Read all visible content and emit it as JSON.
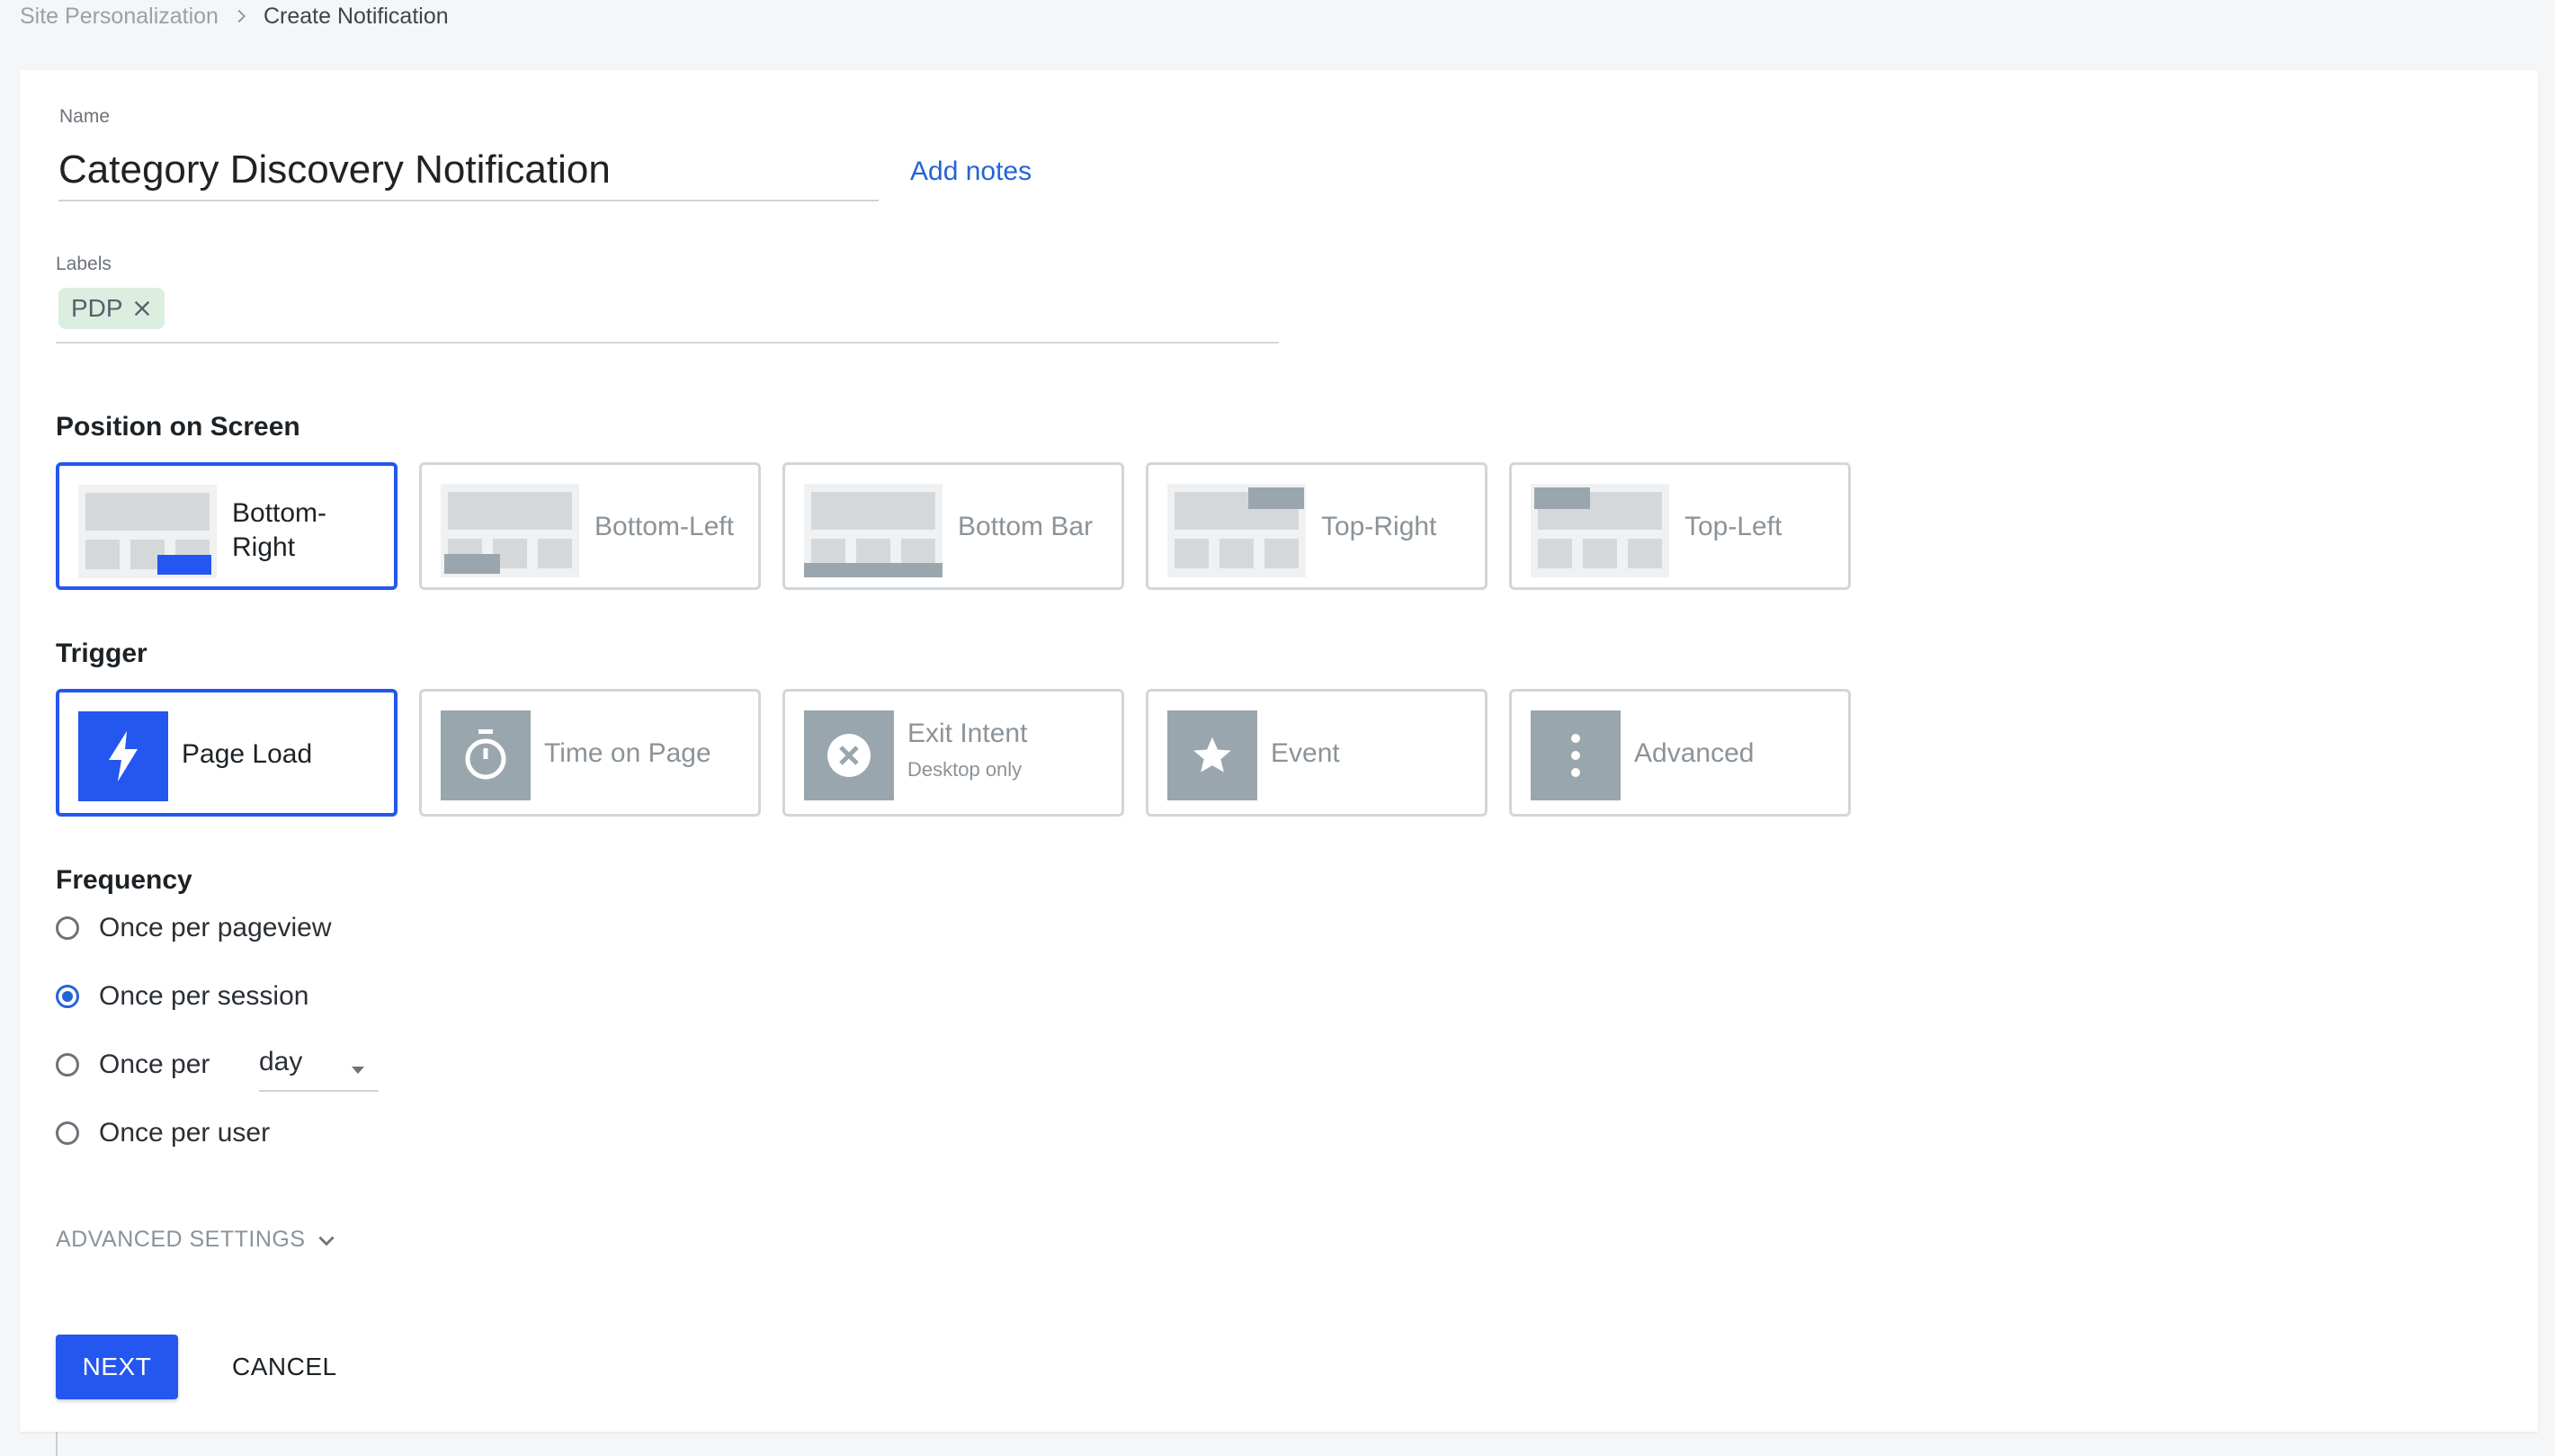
{
  "breadcrumb": {
    "parent": "Site Personalization",
    "current": "Create Notification"
  },
  "form": {
    "name_label": "Name",
    "name_value": "Category Discovery Notification",
    "add_notes": "Add notes",
    "labels_label": "Labels",
    "labels": [
      "PDP"
    ]
  },
  "position": {
    "title": "Position on Screen",
    "options": [
      {
        "line1": "Bottom-",
        "line2": "Right",
        "selected": true
      },
      {
        "label": "Bottom-Left",
        "selected": false
      },
      {
        "label": "Bottom Bar",
        "selected": false
      },
      {
        "label": "Top-Right",
        "selected": false
      },
      {
        "label": "Top-Left",
        "selected": false
      }
    ]
  },
  "trigger": {
    "title": "Trigger",
    "options": [
      {
        "label": "Page Load",
        "icon": "lightning-icon",
        "selected": true
      },
      {
        "label": "Time on Page",
        "icon": "stopwatch-icon",
        "selected": false
      },
      {
        "label": "Exit Intent",
        "sub": "Desktop only",
        "icon": "close-circle-icon",
        "selected": false
      },
      {
        "label": "Event",
        "icon": "star-icon",
        "selected": false
      },
      {
        "label": "Advanced",
        "icon": "more-vertical-icon",
        "selected": false
      }
    ]
  },
  "frequency": {
    "title": "Frequency",
    "options": [
      {
        "label": "Once per pageview",
        "selected": false
      },
      {
        "label": "Once per session",
        "selected": true
      },
      {
        "label": "Once per",
        "select_value": "day",
        "selected": false
      },
      {
        "label": "Once per user",
        "selected": false
      }
    ]
  },
  "advanced_settings": "ADVANCED SETTINGS",
  "actions": {
    "next": "NEXT",
    "cancel": "CANCEL"
  },
  "colors": {
    "accent": "#2457f0",
    "link": "#2563d8",
    "chip_bg": "#dbeee0",
    "icon_gray": "#9aa6ad"
  }
}
